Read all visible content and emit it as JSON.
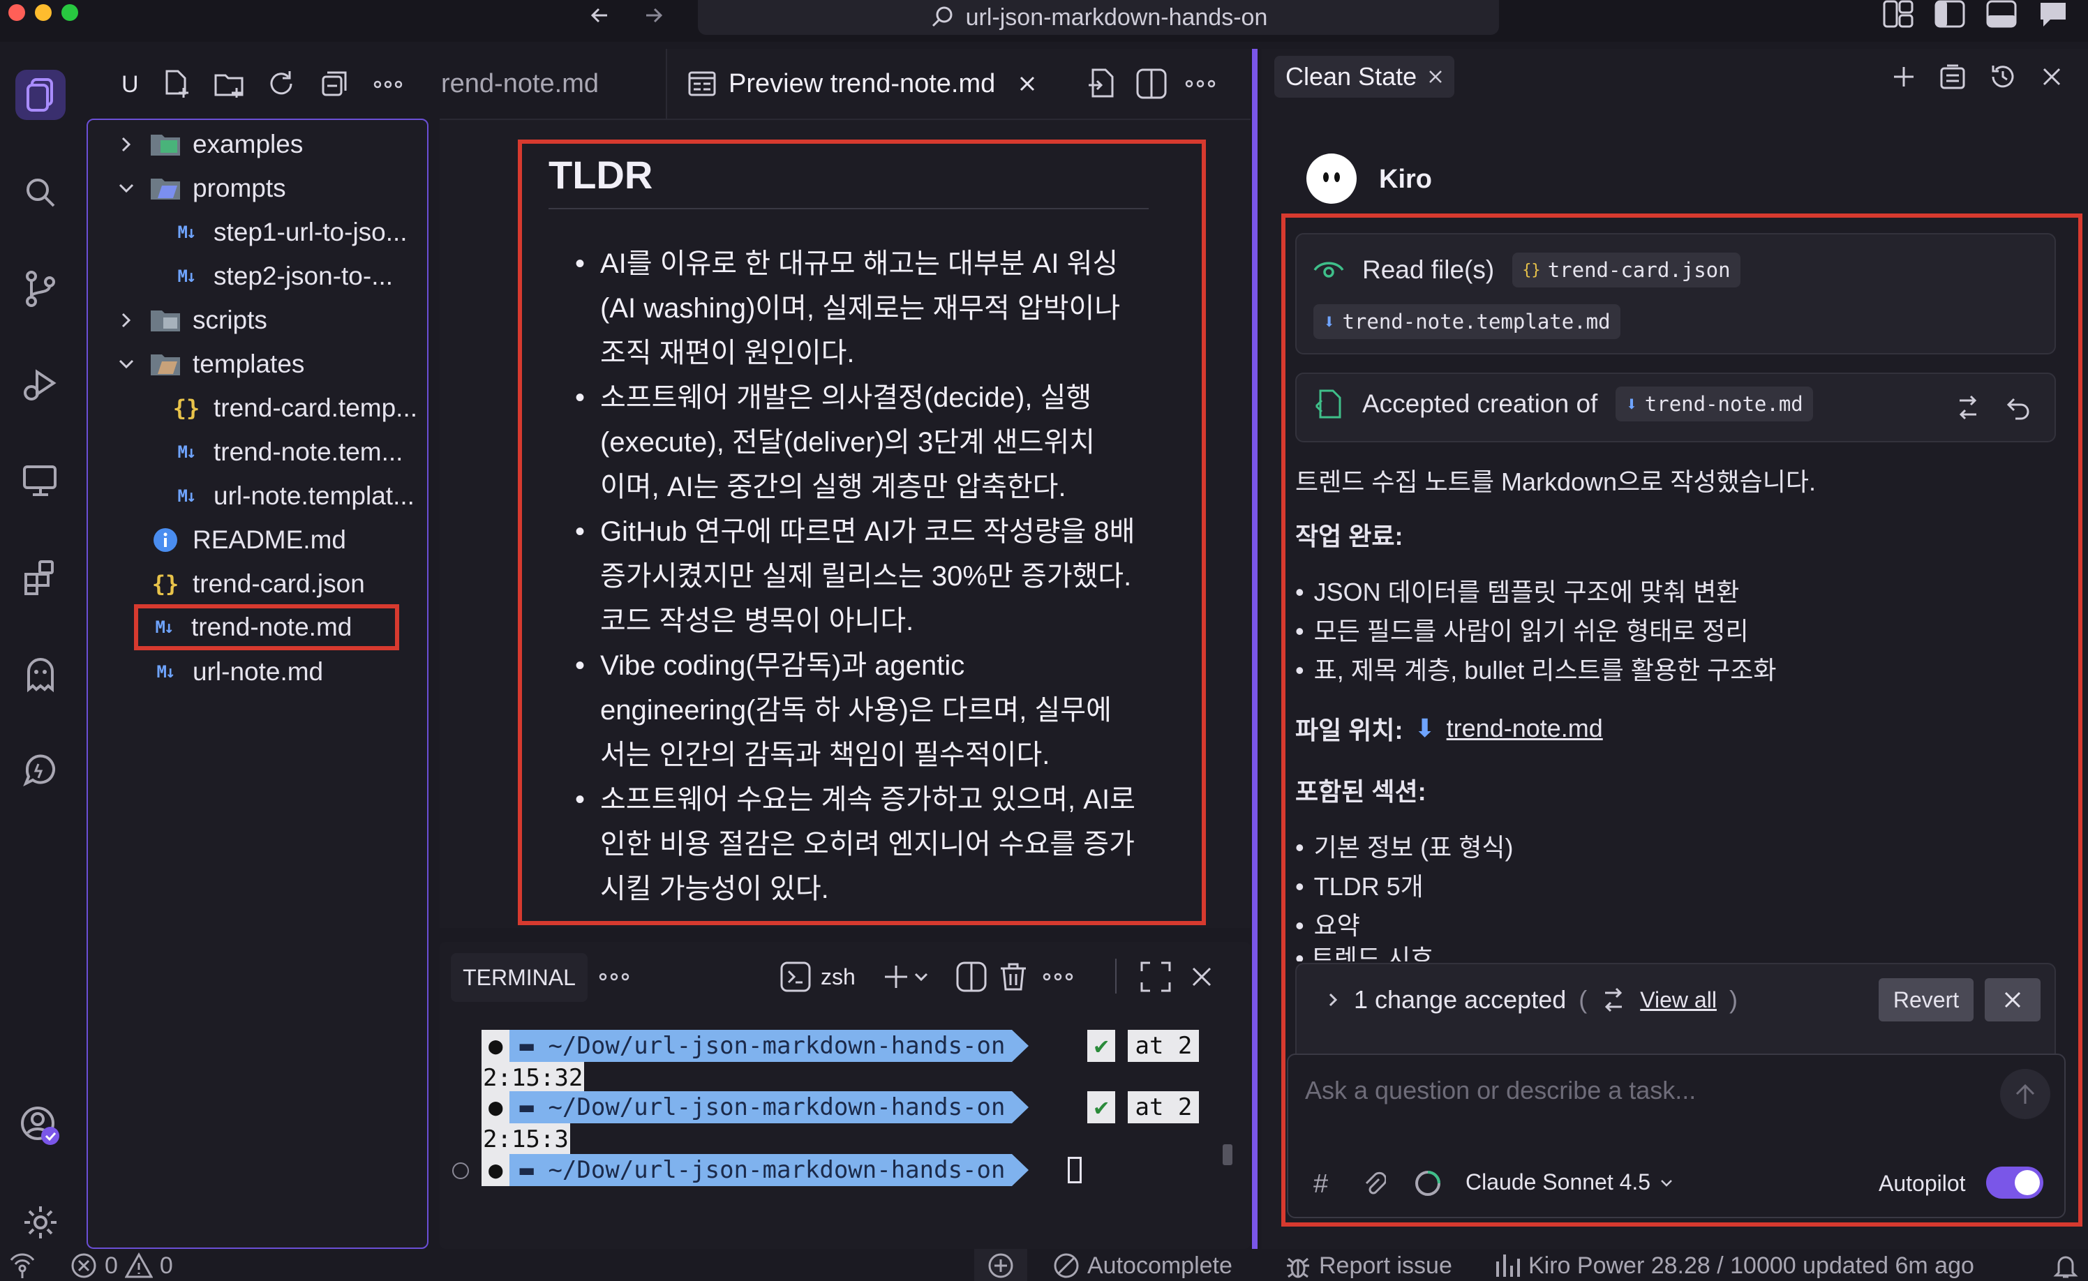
{
  "window": {
    "title": "url-json-markdown-hands-on"
  },
  "colors": {
    "accent": "#7a56e8",
    "highlight": "#d73a2f",
    "md_icon": "#6fa4ff",
    "json_icon": "#e8c34a"
  },
  "activity_bar": {
    "items": [
      "explorer-icon",
      "search-icon",
      "source-control-icon",
      "run-debug-icon",
      "remote-explorer-icon",
      "extensions-icon",
      "kiro-ghost-icon",
      "kiro-chat-icon",
      "account-icon",
      "settings-gear-icon"
    ]
  },
  "explorer": {
    "header_label": "U",
    "tree": [
      {
        "label": "examples",
        "type": "folder",
        "expanded": false
      },
      {
        "label": "prompts",
        "type": "folder",
        "expanded": true
      },
      {
        "label": "step1-url-to-jso...",
        "type": "md"
      },
      {
        "label": "step2-json-to-...",
        "type": "md"
      },
      {
        "label": "scripts",
        "type": "folder",
        "expanded": false
      },
      {
        "label": "templates",
        "type": "folder",
        "expanded": true
      },
      {
        "label": "trend-card.temp...",
        "type": "json"
      },
      {
        "label": "trend-note.tem...",
        "type": "md"
      },
      {
        "label": "url-note.templat...",
        "type": "md"
      },
      {
        "label": "README.md",
        "type": "info"
      },
      {
        "label": "trend-card.json",
        "type": "json"
      },
      {
        "label": "trend-note.md",
        "type": "md",
        "selected": true
      },
      {
        "label": "url-note.md",
        "type": "md"
      }
    ]
  },
  "editor": {
    "tabs": [
      {
        "label": "rend-note.md",
        "active": false
      },
      {
        "label": "Preview trend-note.md",
        "active": true
      }
    ],
    "preview": {
      "heading": "TLDR",
      "bullets": [
        [
          "AI를 이유로 한 대규모 해고는 대부분 AI 워싱",
          "(AI washing)이며, 실제로는 재무적 압박이나",
          "조직 재편이 원인이다."
        ],
        [
          "소프트웨어 개발은 의사결정(decide), 실행",
          "(execute), 전달(deliver)의 3단계 샌드위치",
          "이며, AI는 중간의 실행 계층만 압축한다."
        ],
        [
          "GitHub 연구에 따르면 AI가 코드 작성량을 8배",
          "증가시켰지만 실제 릴리스는 30%만 증가했다.",
          "코드 작성은 병목이 아니다."
        ],
        [
          "Vibe coding(무감독)과 agentic",
          "engineering(감독 하 사용)은 다르며, 실무에",
          "서는 인간의 감독과 책임이 필수적이다."
        ],
        [
          "소프트웨어 수요는 계속 증가하고 있으며, AI로",
          "인한 비용 절감은 오히려 엔지니어 수요를 증가",
          "시킬 가능성이 있다."
        ]
      ]
    }
  },
  "terminal": {
    "tab_label": "TERMINAL",
    "shell_label": "zsh",
    "prompt_path": "~/Dow/url-json-markdown-hands-on",
    "prompt_check": "✔",
    "prompt_at": "at 2",
    "lines": [
      {
        "time": "2:15:32"
      },
      {
        "time": "2:15:3"
      }
    ]
  },
  "chat": {
    "session_tab": "Clean State",
    "agent_name": "Kiro",
    "read_files": {
      "label": "Read file(s)",
      "files": [
        "trend-card.json",
        "trend-note.template.md"
      ]
    },
    "accepted": {
      "label": "Accepted creation of",
      "file": "trend-note.md"
    },
    "message": {
      "intro": "트렌드 수집 노트를 Markdown으로 작성했습니다.",
      "done_heading": "작업 완료:",
      "done_items": [
        "JSON 데이터를 템플릿 구조에 맞춰 변환",
        "모든 필드를 사람이 읽기 쉬운 형태로 정리",
        "표, 제목 계층, bullet 리스트를 활용한 구조화"
      ],
      "location_label": "파일 위치:",
      "location_file": "trend-note.md",
      "sections_heading": "포함된 섹션:",
      "section_items": [
        "기본 정보 (표 형식)",
        "TLDR 5개",
        "요약",
        "트렌드 시호"
      ]
    },
    "changes": {
      "summary": "1 change accepted",
      "paren_open": "(",
      "paren_close": ")",
      "view_all": "View all",
      "revert": "Revert"
    },
    "input": {
      "placeholder": "Ask a question or describe a task...",
      "model": "Claude Sonnet 4.5",
      "autopilot_label": "Autopilot",
      "autopilot_on": true
    }
  },
  "statusbar": {
    "errors": "0",
    "warnings": "0",
    "autocomplete": "Autocomplete",
    "report_issue": "Report issue",
    "power": "Kiro Power 28.28 / 10000 updated 6m ago"
  }
}
